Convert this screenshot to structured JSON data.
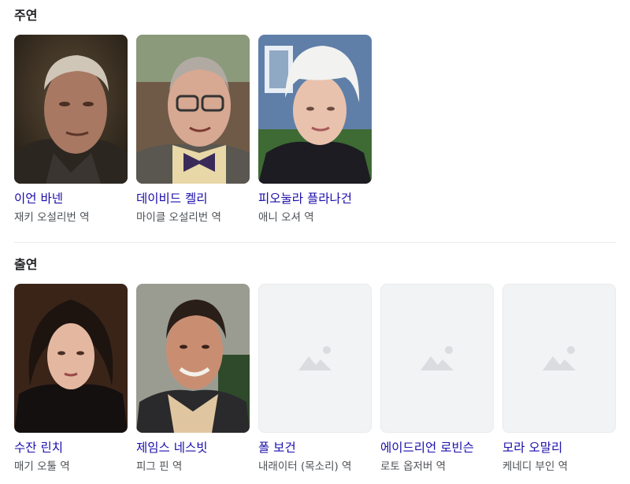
{
  "sections": [
    {
      "title": "주연",
      "cast": [
        {
          "name": "이언 바넨",
          "role": "재키 오설리번 역"
        },
        {
          "name": "데이비드 켈리",
          "role": "마이클 오설리번 역"
        },
        {
          "name": "피오눌라 플라나건",
          "role": "애니 오셔 역"
        }
      ]
    },
    {
      "title": "출연",
      "cast": [
        {
          "name": "수잔 린치",
          "role": "매기 오툴 역"
        },
        {
          "name": "제임스 네스빗",
          "role": "피그 핀 역"
        },
        {
          "name": "폴 보건",
          "role": "내래이터 (목소리) 역"
        },
        {
          "name": "에이드리언 로빈슨",
          "role": "로토 옵저버 역"
        },
        {
          "name": "모라 오말리",
          "role": "케네디 부인 역"
        }
      ]
    }
  ],
  "icons": {
    "placeholder": "image-placeholder-icon"
  },
  "colors": {
    "link": "#1a0dab",
    "secondary_text": "#4d5156",
    "placeholder_bg": "#f1f3f4",
    "placeholder_icon": "#dadce0"
  }
}
